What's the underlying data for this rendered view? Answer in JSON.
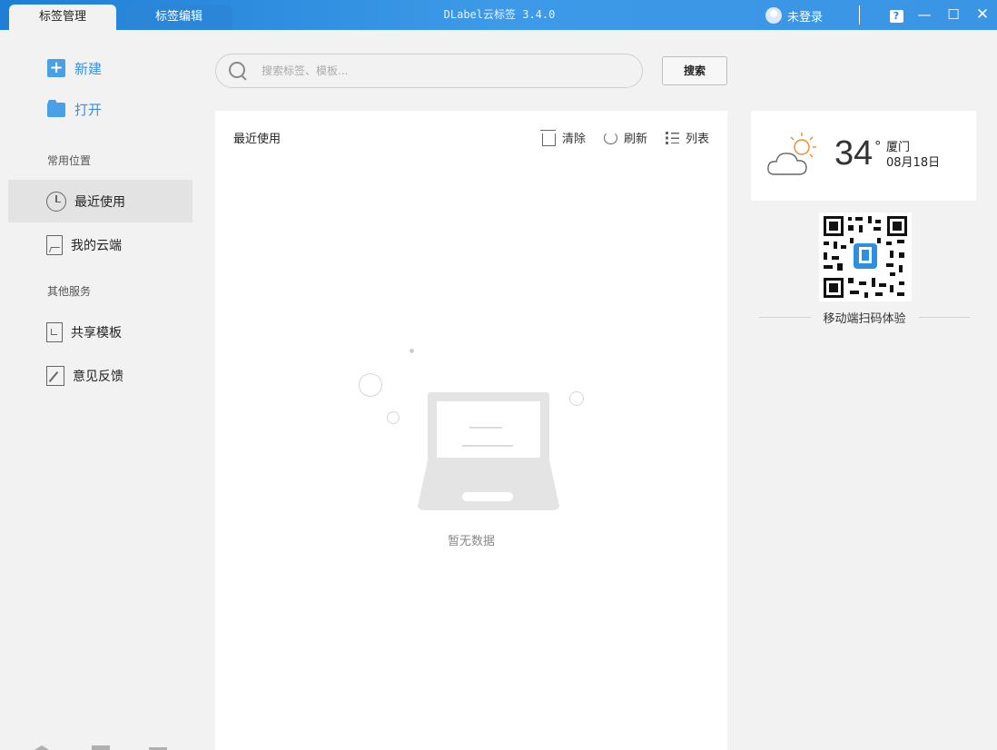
{
  "titlebar": {
    "tabs": [
      {
        "label": "标签管理"
      },
      {
        "label": "标签编辑"
      }
    ],
    "app_title": "DLabel云标签 3.4.0",
    "user_label": "未登录",
    "help_glyph": "?",
    "minimize_glyph": "—",
    "maximize_glyph": "☐",
    "close_glyph": "✕"
  },
  "sidebar": {
    "actions": [
      {
        "label": "新建",
        "icon": "plus-icon"
      },
      {
        "label": "打开",
        "icon": "folder-icon"
      }
    ],
    "section_common": "常用位置",
    "common_items": [
      {
        "label": "最近使用",
        "icon": "clock-icon"
      },
      {
        "label": "我的云端",
        "icon": "cloud-doc-icon"
      }
    ],
    "section_other": "其他服务",
    "other_items": [
      {
        "label": "共享模板",
        "icon": "share-template-icon"
      },
      {
        "label": "意见反馈",
        "icon": "edit-icon"
      }
    ]
  },
  "search": {
    "placeholder": "搜索标签、模板...",
    "button_label": "搜索"
  },
  "main": {
    "title": "最近使用",
    "tools": [
      {
        "label": "清除",
        "icon": "basket-icon"
      },
      {
        "label": "刷新",
        "icon": "refresh-icon"
      },
      {
        "label": "列表",
        "icon": "list-icon"
      }
    ],
    "empty_text": "暂无数据"
  },
  "weather": {
    "temperature": "34",
    "degree": "°",
    "city": "厦门",
    "date": "08月18日"
  },
  "qr": {
    "caption": "移动端扫码体验"
  },
  "colors": {
    "accent": "#3a8fdc",
    "titlebar": "#2b86d8",
    "active_nav": "#e3e3e3"
  }
}
